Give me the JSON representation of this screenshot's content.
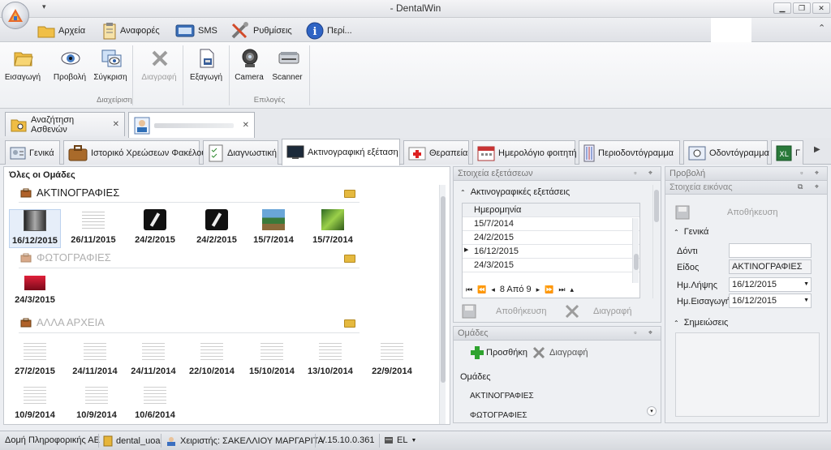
{
  "window": {
    "title": "- DentalWin"
  },
  "menu": {
    "items": [
      {
        "label": "Αρχεία",
        "icon": "folder-icon"
      },
      {
        "label": "Αναφορές",
        "icon": "clipboard-icon"
      },
      {
        "label": "SMS",
        "icon": "sms-icon"
      },
      {
        "label": "Ρυθμίσεις",
        "icon": "tools-icon"
      },
      {
        "label": "Περί...",
        "icon": "info-icon"
      }
    ]
  },
  "ribbon": {
    "buttons": [
      {
        "label": "Εισαγωγή",
        "icon": "open-folder-icon",
        "enabled": true
      },
      {
        "label": "Προβολή",
        "icon": "eye-icon",
        "enabled": true
      },
      {
        "label": "Σύγκριση",
        "icon": "compare-icon",
        "enabled": true
      },
      {
        "label": "Διαγραφή",
        "icon": "delete-x-icon",
        "enabled": false
      },
      {
        "label": "Εξαγωγή",
        "icon": "export-icon",
        "enabled": true
      },
      {
        "label": "Camera",
        "icon": "camera-icon",
        "enabled": true
      },
      {
        "label": "Scanner",
        "icon": "scanner-icon",
        "enabled": true
      }
    ],
    "group1": "Διαχείριση",
    "group2": "Επιλογές"
  },
  "doc_tabs": [
    {
      "label": "Αναζήτηση Ασθενών",
      "icon": "search-folder-icon"
    },
    {
      "label": "",
      "icon": "patient-icon"
    }
  ],
  "page_tabs": [
    {
      "label": "Γενικά",
      "icon": "general-icon"
    },
    {
      "label": "Ιστορικό Χρεώσεων Φακέλου",
      "icon": "briefcase-icon"
    },
    {
      "label": "Διαγνωστική",
      "icon": "checklist-icon"
    },
    {
      "label": "Ακτινογραφική εξέταση",
      "icon": "xray-monitor-icon"
    },
    {
      "label": "Θεραπεία",
      "icon": "medical-kit-icon"
    },
    {
      "label": "Ημερολόγιο φοιτητή",
      "icon": "calendar-icon"
    },
    {
      "label": "Περιοδοντόγραμμα",
      "icon": "perio-chart-icon"
    },
    {
      "label": "Οδοντόγραμμα",
      "icon": "odontogram-icon"
    },
    {
      "label": "Γ",
      "icon": "excel-icon"
    }
  ],
  "left": {
    "title": "Όλες οι Ομάδες",
    "groups": [
      {
        "name": "ΑΚΤΙΝΟΓΡΑΦΙΕΣ",
        "items": [
          "16/12/2015",
          "26/11/2015",
          "24/2/2015",
          "24/2/2015",
          "15/7/2014",
          "15/7/2014"
        ]
      },
      {
        "name": "ΦΩΤΟΓΡΑΦΙΕΣ",
        "items": [
          "24/3/2015"
        ]
      },
      {
        "name": "ΑΛΛΑ ΑΡΧΕΙΑ",
        "items": [
          "27/2/2015",
          "24/11/2014",
          "24/11/2014",
          "22/10/2014",
          "15/10/2014",
          "13/10/2014",
          "22/9/2014",
          "10/9/2014",
          "10/9/2014",
          "10/6/2014"
        ]
      }
    ]
  },
  "exam": {
    "header": "Στοιχεία εξετάσεων",
    "section": "Ακτινογραφικές εξετάσεις",
    "column": "Ημερομηνία",
    "rows": [
      "15/7/2014",
      "24/2/2015",
      "16/12/2015",
      "24/3/2015"
    ],
    "nav": "8 Από 9",
    "save": "Αποθήκευση",
    "delete": "Διαγραφή"
  },
  "groups_panel": {
    "header": "Ομάδες",
    "add": "Προσθήκη",
    "delete": "Διαγραφή",
    "column": "Ομάδες",
    "rows": [
      "ΑΚΤΙΝΟΓΡΑΦΙΕΣ",
      "ΦΩΤΟΓΡΑΦΙΕΣ"
    ]
  },
  "view": {
    "header": "Προβολή",
    "sub": "Στοιχεία εικόνας",
    "save": "Αποθήκευση",
    "general": "Γενικά",
    "tooth_label": "Δόντι",
    "tooth_value": "",
    "type_label": "Είδος",
    "type_value": "ΑΚΤΙΝΟΓΡΑΦΙΕΣ",
    "taken_label": "Ημ.Λήψης",
    "taken_value": "16/12/2015",
    "import_label": "Ημ.Εισαγωγής",
    "import_value": "16/12/2015",
    "notes": "Σημειώσεις"
  },
  "status": {
    "company": "Δομή Πληροφορικής ΑΕ",
    "db": "dental_uoa",
    "user": "Χειριστής: ΣΑΚΕΛΛΙΟΥ ΜΑΡΓΑΡΙΤΑ",
    "version": "V.15.10.0.361",
    "lang": "EL"
  }
}
